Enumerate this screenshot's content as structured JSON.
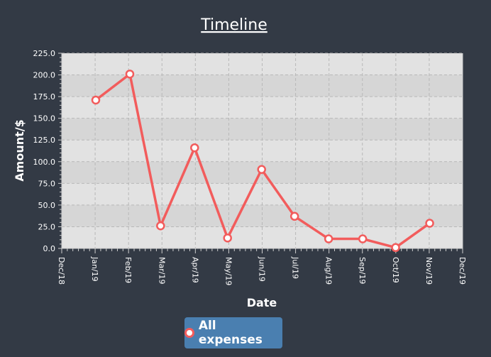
{
  "chart_data": {
    "type": "line",
    "title": "Timeline",
    "xlabel": "Date",
    "ylabel": "Amount/$",
    "x_ticks": [
      "Dec/18",
      "Jan/19",
      "Feb/19",
      "Mar/19",
      "Apr/19",
      "May/19",
      "Jun/19",
      "Jul/19",
      "Aug/19",
      "Sep/19",
      "Oct/19",
      "Nov/19",
      "Dec/19"
    ],
    "y_ticks": [
      "0.0",
      "25.0",
      "50.0",
      "75.0",
      "100.0",
      "125.0",
      "150.0",
      "175.0",
      "200.0",
      "225.0"
    ],
    "ylim": [
      0,
      225
    ],
    "grid": true,
    "series": [
      {
        "name": "All expenses",
        "color": "#f25c5c",
        "x": [
          "2019-01-01",
          "2019-02-01",
          "2019-03-01",
          "2019-04-01",
          "2019-05-01",
          "2019-06-01",
          "2019-07-01",
          "2019-08-01",
          "2019-09-01",
          "2019-10-01",
          "2019-11-01"
        ],
        "values": [
          171,
          201,
          26,
          116,
          12,
          91,
          37,
          11,
          11,
          1,
          29
        ]
      }
    ]
  },
  "legend": {
    "label": "All expenses"
  }
}
